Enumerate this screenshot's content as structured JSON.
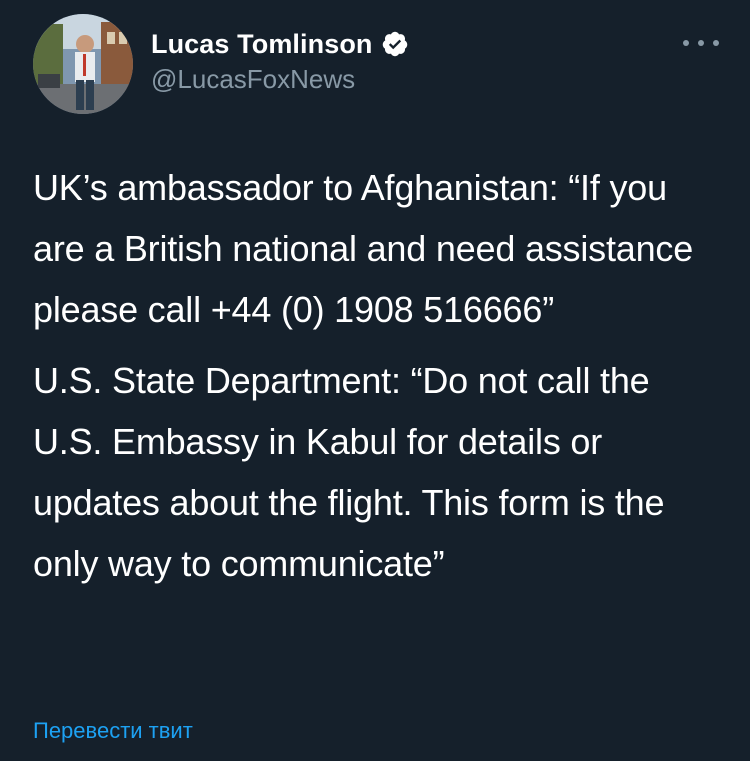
{
  "author": {
    "display_name": "Lucas Tomlinson",
    "handle": "@LucasFoxNews",
    "verified_icon": "verified-badge-icon",
    "avatar_icon": "avatar"
  },
  "menu": {
    "icon": "more-options-icon"
  },
  "tweet": {
    "paragraphs": [
      "UK’s ambassador to Afghanistan: “If you are a British national and need assistance please call +44 (0) 1908 516666”",
      "U.S. State Department: “Do not call the U.S. Embassy in Kabul for details or updates about the flight. This form is the only way to communicate”"
    ]
  },
  "translate": {
    "label": "Перевести твит"
  },
  "colors": {
    "background": "#15202b",
    "text": "#ffffff",
    "secondary": "#8899a6",
    "link": "#1da1f2"
  }
}
